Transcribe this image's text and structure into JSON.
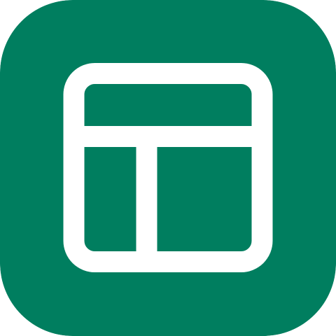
{
  "icon": {
    "name": "layout-icon",
    "colors": {
      "background": "#007E5F",
      "glyph": "#FFFFFF"
    }
  }
}
